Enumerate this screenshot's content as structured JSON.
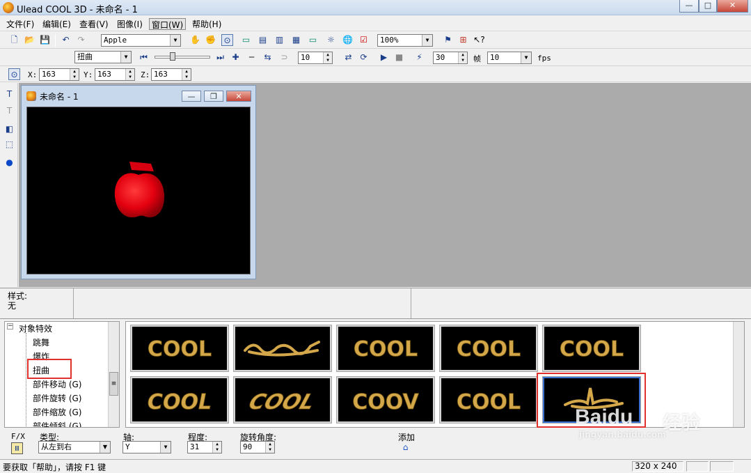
{
  "window": {
    "title": "Ulead COOL 3D - 未命名 - 1",
    "min_label": "—",
    "max_label": "□",
    "close_label": "✕"
  },
  "menu": [
    "文件(F)",
    "编辑(E)",
    "查看(V)",
    "图像(I)",
    "窗口(W)",
    "帮助(H)"
  ],
  "toolbar": {
    "object_name": "Apple",
    "zoom": "100%",
    "effect": "扭曲",
    "frame_value": "10",
    "frames": "30",
    "frame_label": "帧",
    "fps": "10",
    "fps_label": "fps"
  },
  "coords": {
    "x_label": "X:",
    "x": "163",
    "y_label": "Y:",
    "y": "163",
    "z_label": "Z:",
    "z": "163"
  },
  "child_window": {
    "title": "未命名 - 1"
  },
  "style_panel": {
    "label": "样式:",
    "value": "无"
  },
  "tree": {
    "root": "对象特效",
    "items": [
      "跳舞",
      "爆炸",
      "扭曲",
      "部件移动 (G)",
      "部件旋转 (G)",
      "部件缩放 (G)",
      "部件倾斜 (G)"
    ],
    "selected": "扭曲"
  },
  "gallery": {
    "row1": [
      "COOL",
      "twist",
      "COOL",
      "COOL",
      "COOL"
    ],
    "row2": [
      "COOL",
      "COOL",
      "COOV",
      "COOL",
      "twist"
    ],
    "thumb_text": "COOL",
    "thumb_text_partial": "COOV",
    "selected_index": 9
  },
  "properties": {
    "fx_label": "F/X",
    "type_label": "类型:",
    "type_value": "从左到右",
    "axis_label": "轴:",
    "axis_value": "Y",
    "degree_label": "程度:",
    "degree_value": "31",
    "angle_label": "旋转角度:",
    "angle_value": "90",
    "add_label": "添加"
  },
  "status": {
    "help": "要获取「帮助」，请按 F1 键",
    "size": "320 x 240"
  },
  "watermark": {
    "brand": "Baidu",
    "cn": "经验",
    "url": "jingyan.baidu.com"
  },
  "colors": {
    "accent_red": "#e0312c",
    "gold": "#d4a84a",
    "apple": "#e3000f"
  }
}
